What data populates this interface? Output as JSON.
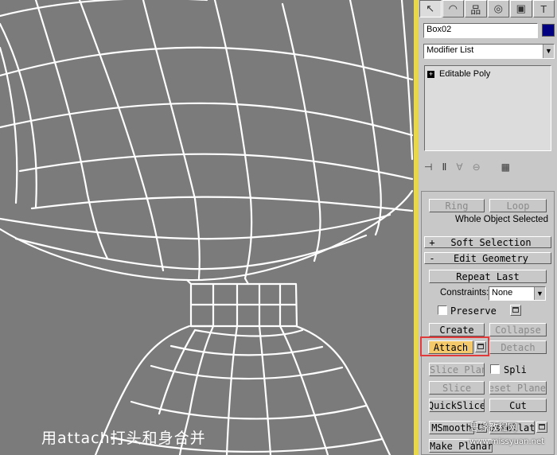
{
  "viewport": {
    "caption": "用attach打头和身合并",
    "wire_color": "#ffffff",
    "background": "#7b7b7b"
  },
  "command_panel": {
    "tabs": [
      {
        "icon": "create-arrow-icon",
        "glyph": "↖"
      },
      {
        "icon": "modify-icon",
        "glyph": "◠"
      },
      {
        "icon": "hierarchy-icon",
        "glyph": "品"
      },
      {
        "icon": "motion-icon",
        "glyph": "◎"
      },
      {
        "icon": "display-icon",
        "glyph": "▣"
      },
      {
        "icon": "utilities-icon",
        "glyph": "T"
      }
    ],
    "object_name": "Box02",
    "object_color": "#000080",
    "modifier_list": "Modifier List",
    "stack_items": [
      "Editable Poly"
    ],
    "stack_tool_icons": [
      "pin-stack-icon",
      "show-end-result-icon",
      "make-unique-icon",
      "remove-modifier-icon",
      "configure-sets-icon"
    ]
  },
  "selection_rollout": {
    "ring_label": "Ring",
    "loop_label": "Loop",
    "status_text": "Whole Object Selected"
  },
  "soft_selection": {
    "sign": "+",
    "title": "Soft Selection"
  },
  "edit_geometry": {
    "sign": "-",
    "title": "Edit Geometry",
    "repeat_last": "Repeat Last",
    "constraints_label": "Constraints:",
    "constraints_value": "None",
    "preserve_label": "Preserve",
    "create": "Create",
    "collapse": "Collapse",
    "attach": "Attach",
    "detach": "Detach",
    "slice_plane": "Slice Plane",
    "split": "Spli",
    "slice": "Slice",
    "reset_plane": "Reset Plane",
    "quickslice": "QuickSlice",
    "cut": "Cut",
    "msmooth": "MSmooth",
    "tessellate": "Tessellate",
    "make_planar": "Make Planar"
  },
  "watermark": {
    "text": "思缘教程网",
    "url": "www.missyuan.net"
  }
}
